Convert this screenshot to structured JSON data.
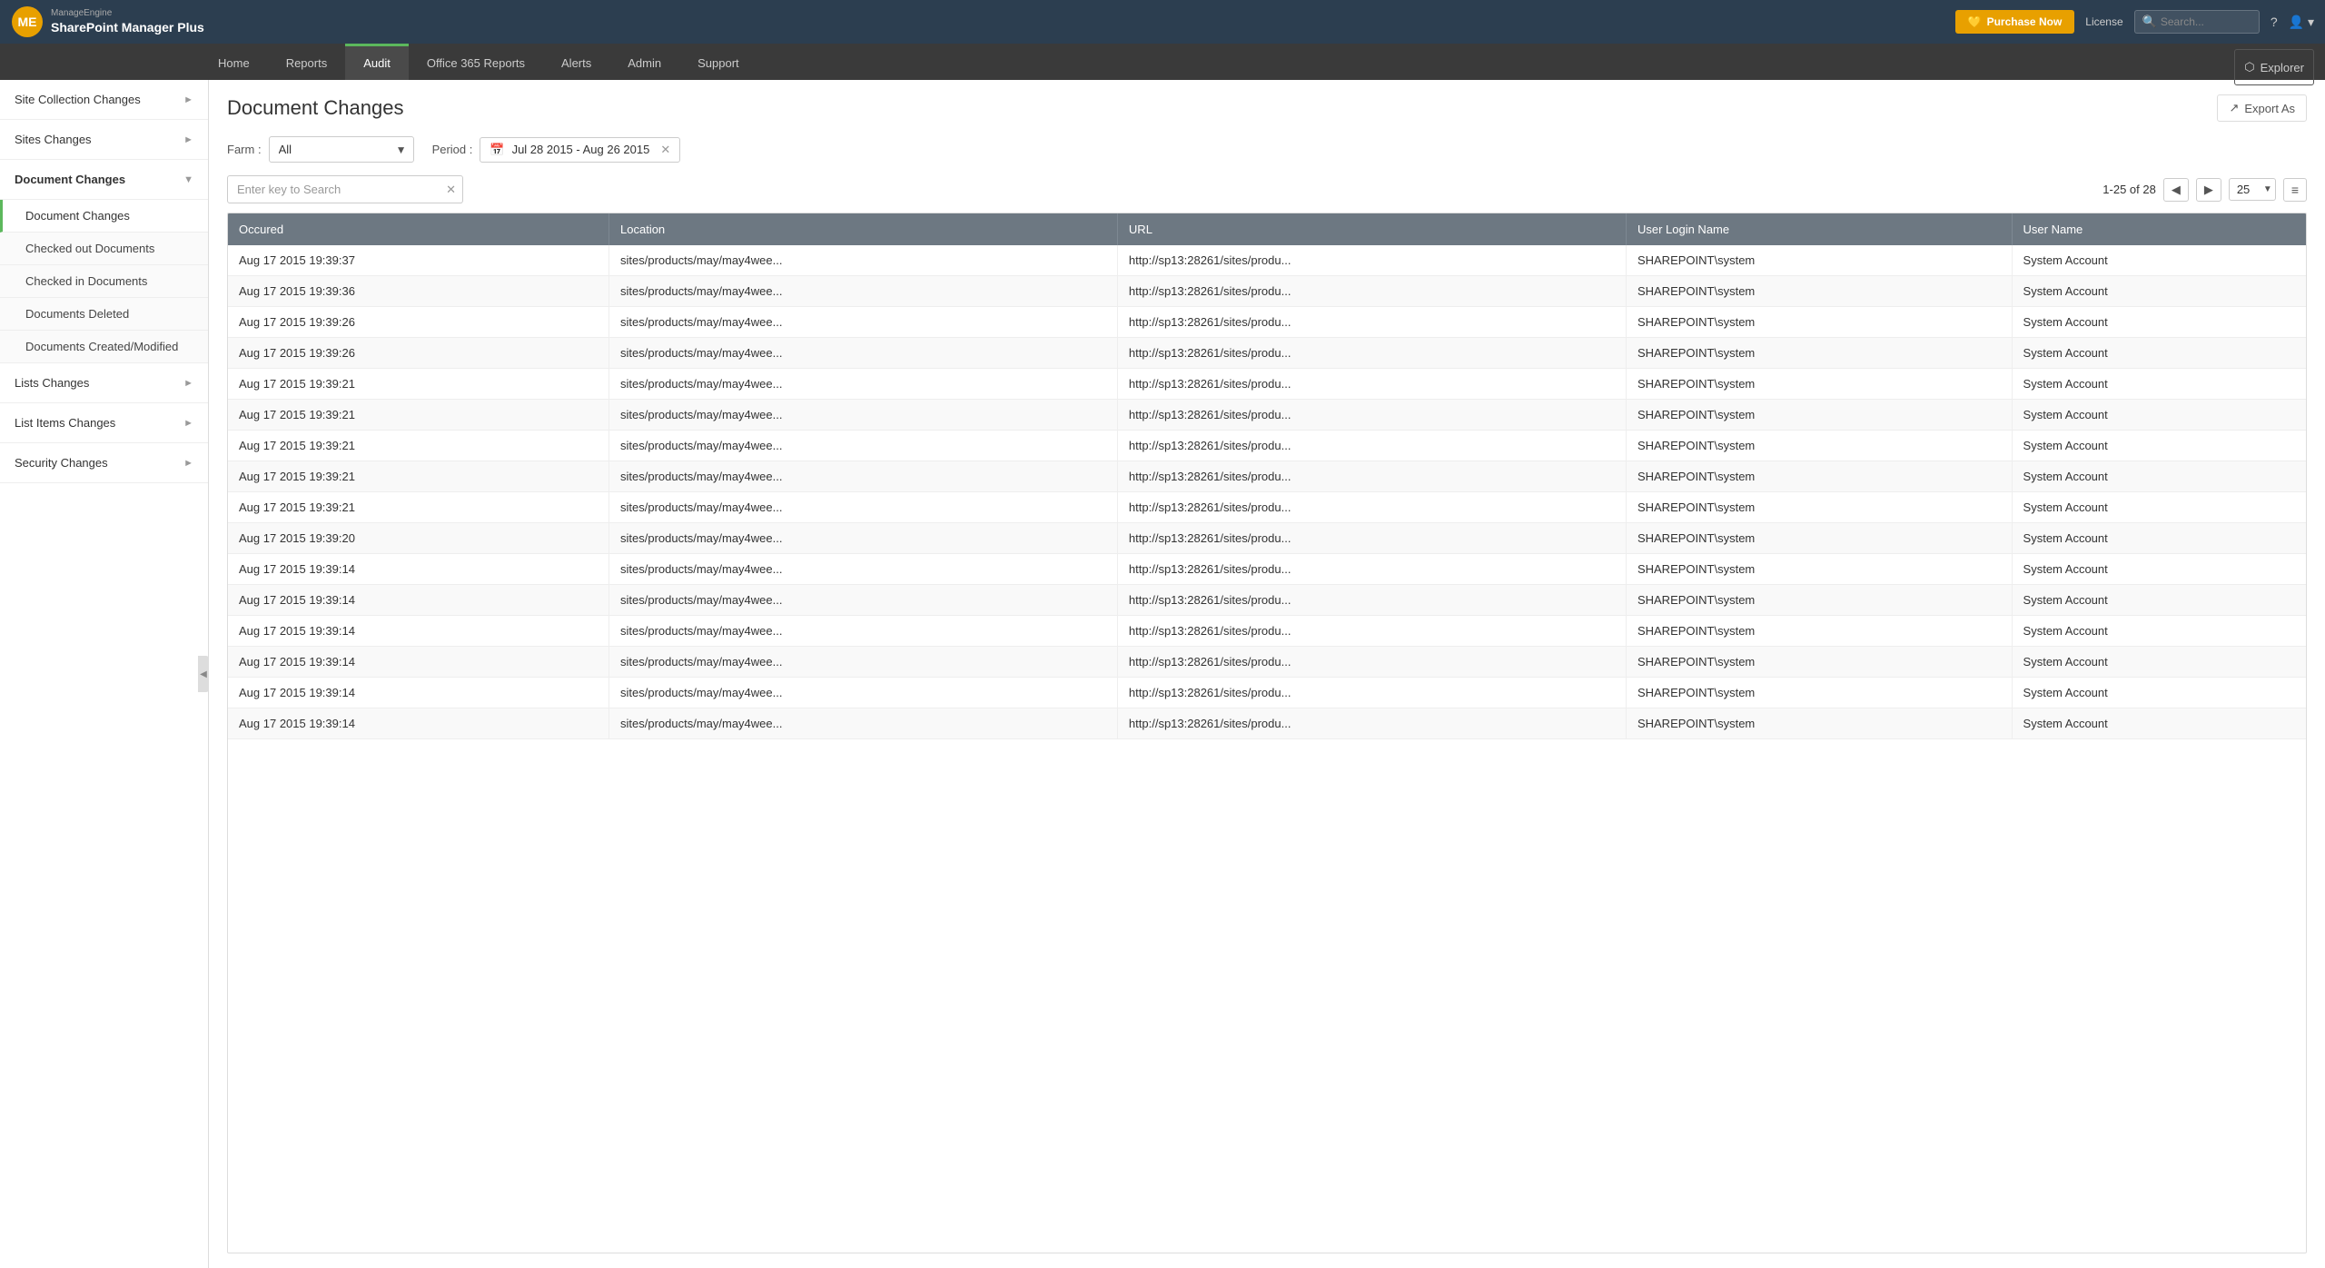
{
  "app": {
    "logo_top": "ManageEngine",
    "logo_main": "SharePoint Manager Plus"
  },
  "header": {
    "purchase_label": "Purchase Now",
    "license_label": "License",
    "search_placeholder": "Search...",
    "explorer_label": "Explorer"
  },
  "nav": {
    "items": [
      {
        "id": "home",
        "label": "Home",
        "active": false
      },
      {
        "id": "reports",
        "label": "Reports",
        "active": false
      },
      {
        "id": "audit",
        "label": "Audit",
        "active": true
      },
      {
        "id": "office365",
        "label": "Office 365 Reports",
        "active": false
      },
      {
        "id": "alerts",
        "label": "Alerts",
        "active": false
      },
      {
        "id": "admin",
        "label": "Admin",
        "active": false
      },
      {
        "id": "support",
        "label": "Support",
        "active": false
      }
    ]
  },
  "sidebar": {
    "items": [
      {
        "id": "site-collection-changes",
        "label": "Site Collection Changes",
        "expanded": false,
        "active": false
      },
      {
        "id": "sites-changes",
        "label": "Sites Changes",
        "expanded": false,
        "active": false
      },
      {
        "id": "document-changes",
        "label": "Document Changes",
        "expanded": true,
        "active": true,
        "children": [
          {
            "id": "document-changes-sub",
            "label": "Document Changes",
            "active": true
          },
          {
            "id": "checked-out-documents",
            "label": "Checked out Documents",
            "active": false
          },
          {
            "id": "checked-in-documents",
            "label": "Checked in Documents",
            "active": false
          },
          {
            "id": "documents-deleted",
            "label": "Documents Deleted",
            "active": false
          },
          {
            "id": "documents-created-modified",
            "label": "Documents Created/Modified",
            "active": false
          }
        ]
      },
      {
        "id": "lists-changes",
        "label": "Lists Changes",
        "expanded": false,
        "active": false
      },
      {
        "id": "list-items-changes",
        "label": "List Items Changes",
        "expanded": false,
        "active": false
      },
      {
        "id": "security-changes",
        "label": "Security Changes",
        "expanded": false,
        "active": false
      }
    ]
  },
  "content": {
    "page_title": "Document Changes",
    "export_label": "Export As",
    "farm_label": "Farm :",
    "farm_value": "All",
    "period_label": "Period :",
    "period_value": "Jul 28 2015 - Aug 26 2015",
    "search_placeholder": "Enter key to Search",
    "pagination": {
      "info": "1-25 of 28",
      "per_page": "25"
    },
    "table": {
      "columns": [
        "Occured",
        "Location",
        "URL",
        "User Login Name",
        "User Name"
      ],
      "rows": [
        {
          "occured": "Aug 17 2015 19:39:37",
          "location": "sites/products/may/may4wee...",
          "url": "http://sp13:28261/sites/produ...",
          "login": "SHAREPOINT\\system",
          "username": "System Account"
        },
        {
          "occured": "Aug 17 2015 19:39:36",
          "location": "sites/products/may/may4wee...",
          "url": "http://sp13:28261/sites/produ...",
          "login": "SHAREPOINT\\system",
          "username": "System Account"
        },
        {
          "occured": "Aug 17 2015 19:39:26",
          "location": "sites/products/may/may4wee...",
          "url": "http://sp13:28261/sites/produ...",
          "login": "SHAREPOINT\\system",
          "username": "System Account"
        },
        {
          "occured": "Aug 17 2015 19:39:26",
          "location": "sites/products/may/may4wee...",
          "url": "http://sp13:28261/sites/produ...",
          "login": "SHAREPOINT\\system",
          "username": "System Account"
        },
        {
          "occured": "Aug 17 2015 19:39:21",
          "location": "sites/products/may/may4wee...",
          "url": "http://sp13:28261/sites/produ...",
          "login": "SHAREPOINT\\system",
          "username": "System Account"
        },
        {
          "occured": "Aug 17 2015 19:39:21",
          "location": "sites/products/may/may4wee...",
          "url": "http://sp13:28261/sites/produ...",
          "login": "SHAREPOINT\\system",
          "username": "System Account"
        },
        {
          "occured": "Aug 17 2015 19:39:21",
          "location": "sites/products/may/may4wee...",
          "url": "http://sp13:28261/sites/produ...",
          "login": "SHAREPOINT\\system",
          "username": "System Account"
        },
        {
          "occured": "Aug 17 2015 19:39:21",
          "location": "sites/products/may/may4wee...",
          "url": "http://sp13:28261/sites/produ...",
          "login": "SHAREPOINT\\system",
          "username": "System Account"
        },
        {
          "occured": "Aug 17 2015 19:39:21",
          "location": "sites/products/may/may4wee...",
          "url": "http://sp13:28261/sites/produ...",
          "login": "SHAREPOINT\\system",
          "username": "System Account"
        },
        {
          "occured": "Aug 17 2015 19:39:20",
          "location": "sites/products/may/may4wee...",
          "url": "http://sp13:28261/sites/produ...",
          "login": "SHAREPOINT\\system",
          "username": "System Account"
        },
        {
          "occured": "Aug 17 2015 19:39:14",
          "location": "sites/products/may/may4wee...",
          "url": "http://sp13:28261/sites/produ...",
          "login": "SHAREPOINT\\system",
          "username": "System Account"
        },
        {
          "occured": "Aug 17 2015 19:39:14",
          "location": "sites/products/may/may4wee...",
          "url": "http://sp13:28261/sites/produ...",
          "login": "SHAREPOINT\\system",
          "username": "System Account"
        },
        {
          "occured": "Aug 17 2015 19:39:14",
          "location": "sites/products/may/may4wee...",
          "url": "http://sp13:28261/sites/produ...",
          "login": "SHAREPOINT\\system",
          "username": "System Account"
        },
        {
          "occured": "Aug 17 2015 19:39:14",
          "location": "sites/products/may/may4wee...",
          "url": "http://sp13:28261/sites/produ...",
          "login": "SHAREPOINT\\system",
          "username": "System Account"
        },
        {
          "occured": "Aug 17 2015 19:39:14",
          "location": "sites/products/may/may4wee...",
          "url": "http://sp13:28261/sites/produ...",
          "login": "SHAREPOINT\\system",
          "username": "System Account"
        },
        {
          "occured": "Aug 17 2015 19:39:14",
          "location": "sites/products/may/may4wee...",
          "url": "http://sp13:28261/sites/produ...",
          "login": "SHAREPOINT\\system",
          "username": "System Account"
        }
      ]
    }
  }
}
